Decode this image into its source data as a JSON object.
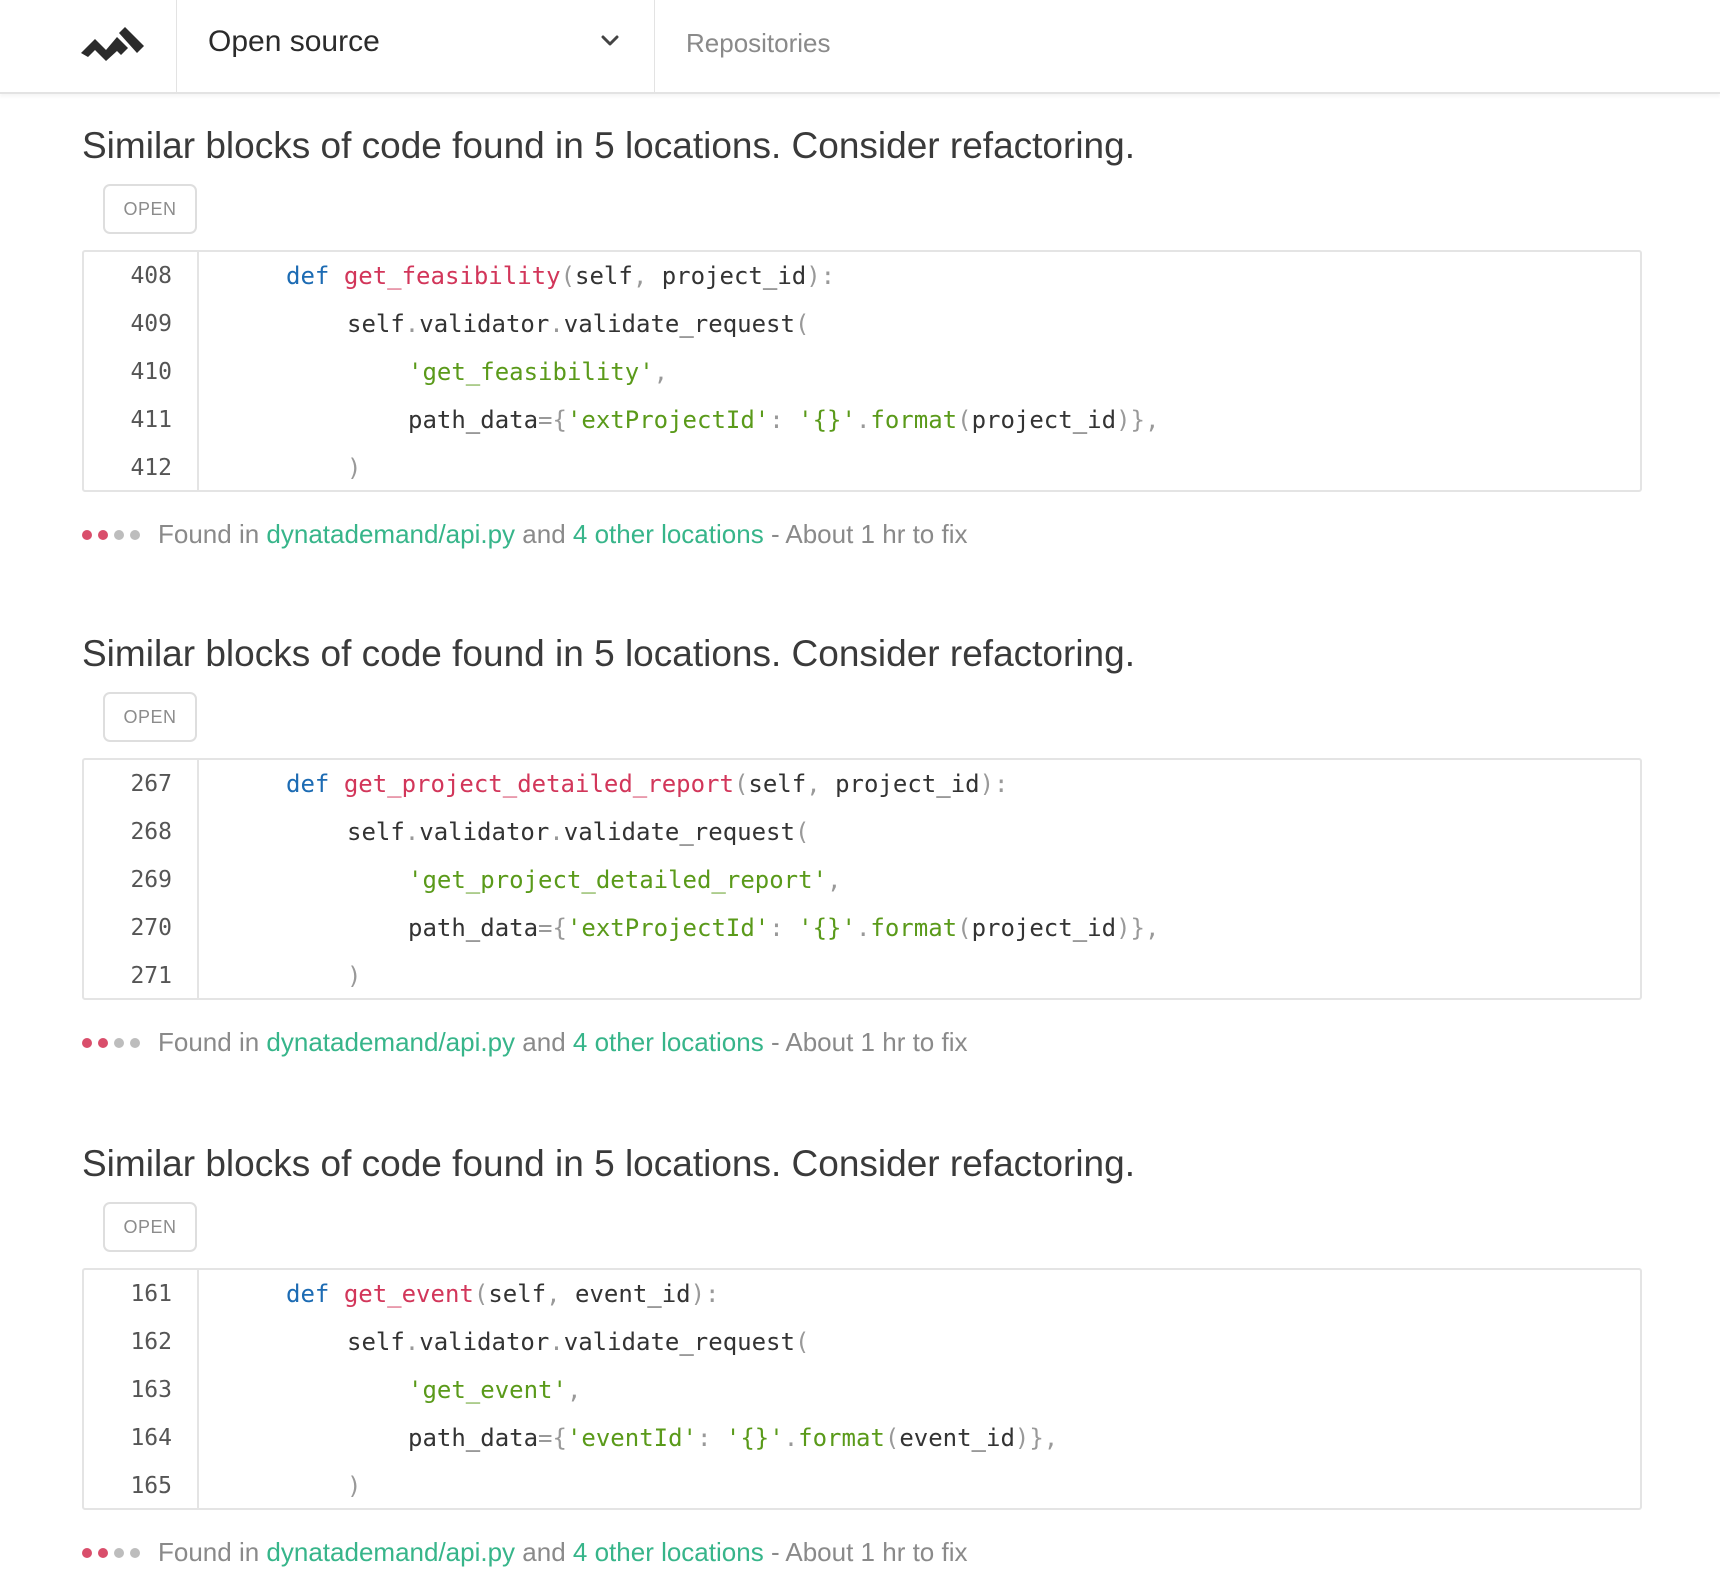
{
  "header": {
    "org_name": "Open source",
    "nav_repositories": "Repositories"
  },
  "colors": {
    "keyword": "#1c6bb3",
    "function": "#d2365a",
    "string": "#5a9a1a",
    "link": "#37b58a",
    "severity_on": "#d94e6b",
    "severity_off": "#bdbdbd"
  },
  "issues": [
    {
      "title": "Similar blocks of code found in 5 locations. Consider refactoring.",
      "status": "OPEN",
      "lines": [
        "408",
        "409",
        "410",
        "411",
        "412"
      ],
      "code": {
        "func": "get_feasibility",
        "param": "project_id",
        "request": "'get_feasibility'",
        "path_key": "'extProjectId'",
        "path_arg": "project_id"
      },
      "footer": {
        "prefix": "Found in",
        "file": "dynatademand/api.py",
        "joiner": "and",
        "others": "4 other locations",
        "suffix": "- About 1 hr to fix"
      },
      "severity": 2
    },
    {
      "title": "Similar blocks of code found in 5 locations. Consider refactoring.",
      "status": "OPEN",
      "lines": [
        "267",
        "268",
        "269",
        "270",
        "271"
      ],
      "code": {
        "func": "get_project_detailed_report",
        "param": "project_id",
        "request": "'get_project_detailed_report'",
        "path_key": "'extProjectId'",
        "path_arg": "project_id"
      },
      "footer": {
        "prefix": "Found in",
        "file": "dynatademand/api.py",
        "joiner": "and",
        "others": "4 other locations",
        "suffix": "- About 1 hr to fix"
      },
      "severity": 2
    },
    {
      "title": "Similar blocks of code found in 5 locations. Consider refactoring.",
      "status": "OPEN",
      "lines": [
        "161",
        "162",
        "163",
        "164",
        "165"
      ],
      "code": {
        "func": "get_event",
        "param": "event_id",
        "request": "'get_event'",
        "path_key": "'eventId'",
        "path_arg": "event_id"
      },
      "footer": {
        "prefix": "Found in",
        "file": "dynatademand/api.py",
        "joiner": "and",
        "others": "4 other locations",
        "suffix": "- About 1 hr to fix"
      },
      "severity": 2
    }
  ]
}
